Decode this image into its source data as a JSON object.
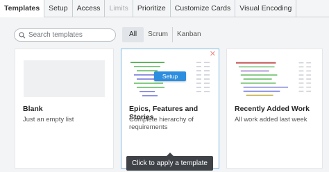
{
  "tabs": [
    {
      "label": "Templates",
      "state": "active"
    },
    {
      "label": "Setup",
      "state": "normal"
    },
    {
      "label": "Access",
      "state": "normal"
    },
    {
      "label": "Limits",
      "state": "disabled"
    },
    {
      "label": "Prioritize",
      "state": "normal"
    },
    {
      "label": "Customize Cards",
      "state": "normal"
    },
    {
      "label": "Visual Encoding",
      "state": "normal"
    }
  ],
  "search": {
    "placeholder": "Search templates",
    "icon": "search-icon"
  },
  "filters": [
    {
      "label": "All",
      "active": true
    },
    {
      "label": "Scrum",
      "active": false
    },
    {
      "label": "Kanban",
      "active": false
    }
  ],
  "cards": [
    {
      "title": "Blank",
      "description": "Just an empty list"
    },
    {
      "title": "Epics, Features and Stories",
      "description": "Complete hierarchy of requirements",
      "hover_button": "Setup",
      "close_icon": "close-icon"
    },
    {
      "title": "Recently Added Work",
      "description": "All work added last week"
    }
  ],
  "tooltip": "Click to apply a template",
  "colors": {
    "accent": "#2d8ee0",
    "selected_border": "#7fb9e6",
    "tooltip_bg": "#3f4247",
    "preview_green": "#5cb85c",
    "preview_blue": "#6a6fd8",
    "preview_red": "#c0504d",
    "preview_purple": "#8e6cc4"
  }
}
